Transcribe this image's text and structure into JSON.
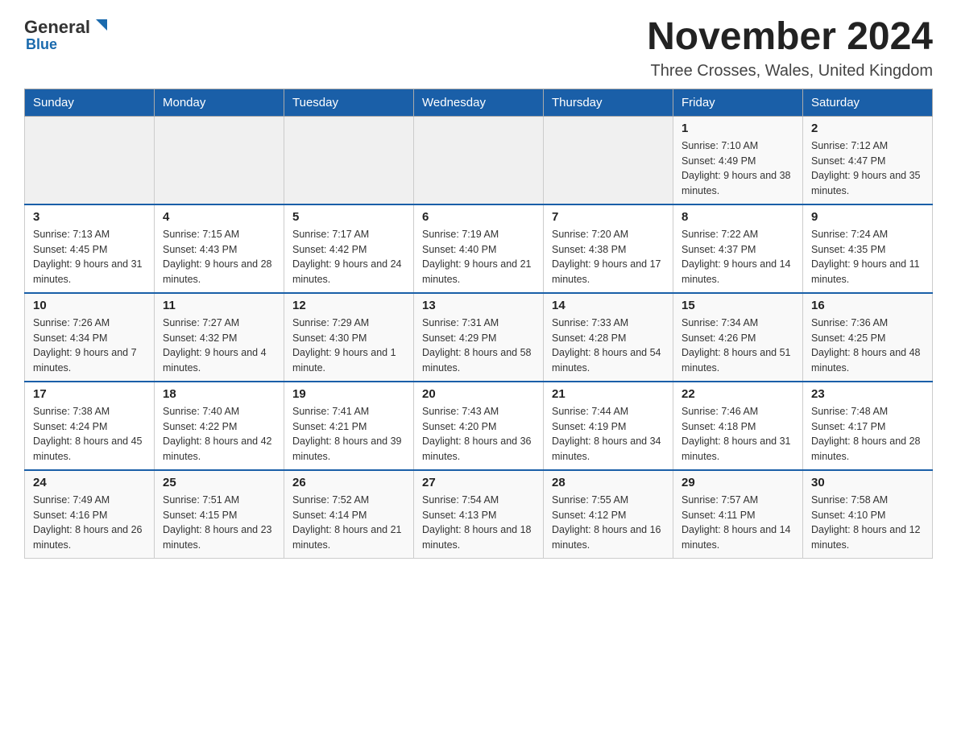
{
  "logo": {
    "text_general": "General",
    "text_blue": "Blue"
  },
  "header": {
    "title": "November 2024",
    "subtitle": "Three Crosses, Wales, United Kingdom"
  },
  "calendar": {
    "weekdays": [
      "Sunday",
      "Monday",
      "Tuesday",
      "Wednesday",
      "Thursday",
      "Friday",
      "Saturday"
    ],
    "rows": [
      {
        "days": [
          {
            "num": "",
            "info": ""
          },
          {
            "num": "",
            "info": ""
          },
          {
            "num": "",
            "info": ""
          },
          {
            "num": "",
            "info": ""
          },
          {
            "num": "",
            "info": ""
          },
          {
            "num": "1",
            "info": "Sunrise: 7:10 AM\nSunset: 4:49 PM\nDaylight: 9 hours and 38 minutes."
          },
          {
            "num": "2",
            "info": "Sunrise: 7:12 AM\nSunset: 4:47 PM\nDaylight: 9 hours and 35 minutes."
          }
        ]
      },
      {
        "days": [
          {
            "num": "3",
            "info": "Sunrise: 7:13 AM\nSunset: 4:45 PM\nDaylight: 9 hours and 31 minutes."
          },
          {
            "num": "4",
            "info": "Sunrise: 7:15 AM\nSunset: 4:43 PM\nDaylight: 9 hours and 28 minutes."
          },
          {
            "num": "5",
            "info": "Sunrise: 7:17 AM\nSunset: 4:42 PM\nDaylight: 9 hours and 24 minutes."
          },
          {
            "num": "6",
            "info": "Sunrise: 7:19 AM\nSunset: 4:40 PM\nDaylight: 9 hours and 21 minutes."
          },
          {
            "num": "7",
            "info": "Sunrise: 7:20 AM\nSunset: 4:38 PM\nDaylight: 9 hours and 17 minutes."
          },
          {
            "num": "8",
            "info": "Sunrise: 7:22 AM\nSunset: 4:37 PM\nDaylight: 9 hours and 14 minutes."
          },
          {
            "num": "9",
            "info": "Sunrise: 7:24 AM\nSunset: 4:35 PM\nDaylight: 9 hours and 11 minutes."
          }
        ]
      },
      {
        "days": [
          {
            "num": "10",
            "info": "Sunrise: 7:26 AM\nSunset: 4:34 PM\nDaylight: 9 hours and 7 minutes."
          },
          {
            "num": "11",
            "info": "Sunrise: 7:27 AM\nSunset: 4:32 PM\nDaylight: 9 hours and 4 minutes."
          },
          {
            "num": "12",
            "info": "Sunrise: 7:29 AM\nSunset: 4:30 PM\nDaylight: 9 hours and 1 minute."
          },
          {
            "num": "13",
            "info": "Sunrise: 7:31 AM\nSunset: 4:29 PM\nDaylight: 8 hours and 58 minutes."
          },
          {
            "num": "14",
            "info": "Sunrise: 7:33 AM\nSunset: 4:28 PM\nDaylight: 8 hours and 54 minutes."
          },
          {
            "num": "15",
            "info": "Sunrise: 7:34 AM\nSunset: 4:26 PM\nDaylight: 8 hours and 51 minutes."
          },
          {
            "num": "16",
            "info": "Sunrise: 7:36 AM\nSunset: 4:25 PM\nDaylight: 8 hours and 48 minutes."
          }
        ]
      },
      {
        "days": [
          {
            "num": "17",
            "info": "Sunrise: 7:38 AM\nSunset: 4:24 PM\nDaylight: 8 hours and 45 minutes."
          },
          {
            "num": "18",
            "info": "Sunrise: 7:40 AM\nSunset: 4:22 PM\nDaylight: 8 hours and 42 minutes."
          },
          {
            "num": "19",
            "info": "Sunrise: 7:41 AM\nSunset: 4:21 PM\nDaylight: 8 hours and 39 minutes."
          },
          {
            "num": "20",
            "info": "Sunrise: 7:43 AM\nSunset: 4:20 PM\nDaylight: 8 hours and 36 minutes."
          },
          {
            "num": "21",
            "info": "Sunrise: 7:44 AM\nSunset: 4:19 PM\nDaylight: 8 hours and 34 minutes."
          },
          {
            "num": "22",
            "info": "Sunrise: 7:46 AM\nSunset: 4:18 PM\nDaylight: 8 hours and 31 minutes."
          },
          {
            "num": "23",
            "info": "Sunrise: 7:48 AM\nSunset: 4:17 PM\nDaylight: 8 hours and 28 minutes."
          }
        ]
      },
      {
        "days": [
          {
            "num": "24",
            "info": "Sunrise: 7:49 AM\nSunset: 4:16 PM\nDaylight: 8 hours and 26 minutes."
          },
          {
            "num": "25",
            "info": "Sunrise: 7:51 AM\nSunset: 4:15 PM\nDaylight: 8 hours and 23 minutes."
          },
          {
            "num": "26",
            "info": "Sunrise: 7:52 AM\nSunset: 4:14 PM\nDaylight: 8 hours and 21 minutes."
          },
          {
            "num": "27",
            "info": "Sunrise: 7:54 AM\nSunset: 4:13 PM\nDaylight: 8 hours and 18 minutes."
          },
          {
            "num": "28",
            "info": "Sunrise: 7:55 AM\nSunset: 4:12 PM\nDaylight: 8 hours and 16 minutes."
          },
          {
            "num": "29",
            "info": "Sunrise: 7:57 AM\nSunset: 4:11 PM\nDaylight: 8 hours and 14 minutes."
          },
          {
            "num": "30",
            "info": "Sunrise: 7:58 AM\nSunset: 4:10 PM\nDaylight: 8 hours and 12 minutes."
          }
        ]
      }
    ]
  }
}
